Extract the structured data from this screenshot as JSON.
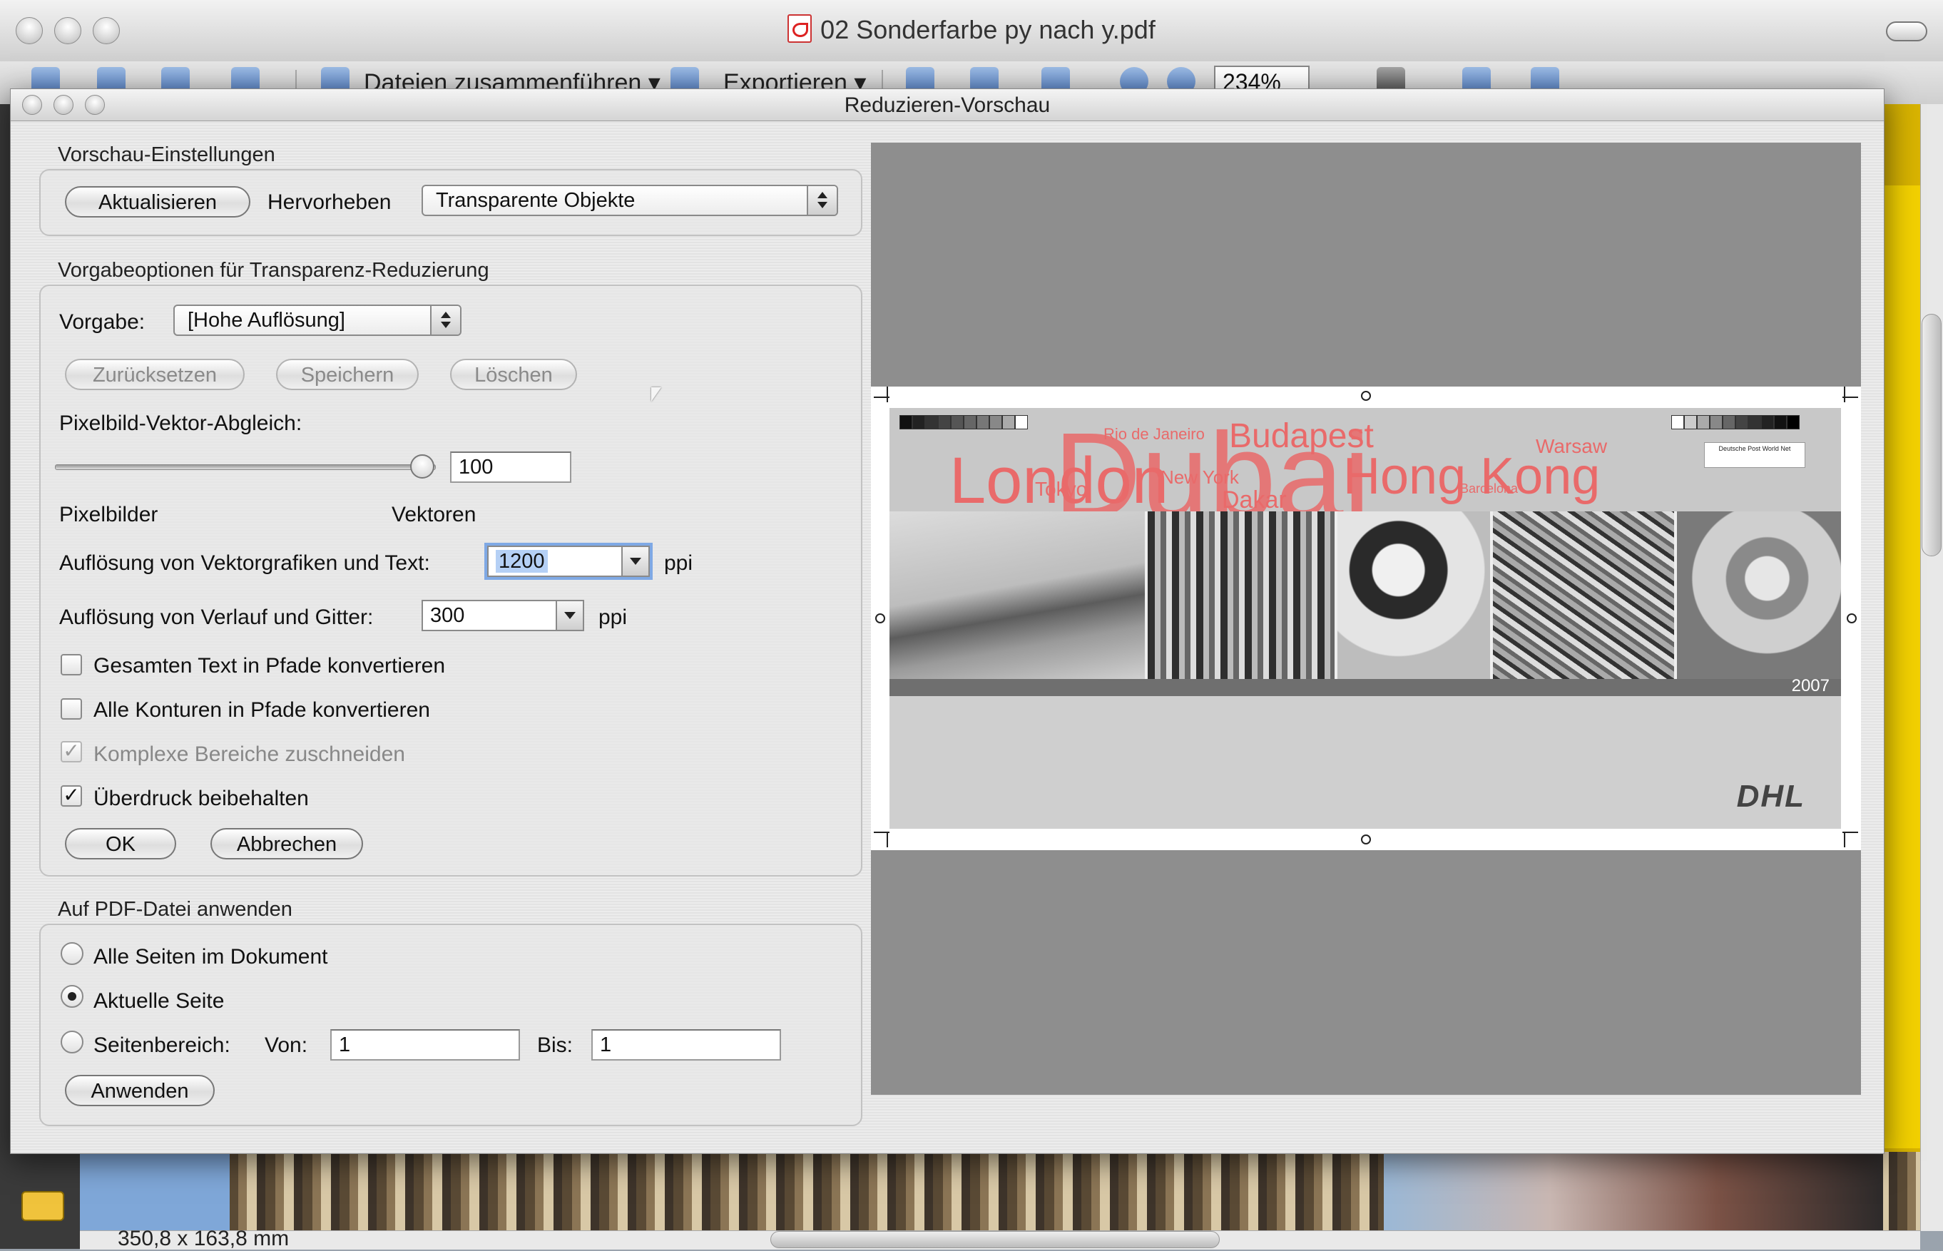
{
  "app": {
    "window_title": "02 Sonderfarbe py nach y.pdf",
    "toolbar": {
      "merge_label": "Dateien zusammenführen ▾",
      "export_label": "Exportieren ▾",
      "zoom_value": "234%"
    },
    "page_size": "350,8 x 163,8 mm"
  },
  "dialog": {
    "title": "Reduzieren-Vorschau",
    "preview_settings": {
      "section_label": "Vorschau-Einstellungen",
      "refresh_button": "Aktualisieren",
      "highlight_label": "Hervorheben",
      "highlight_value": "Transparente Objekte"
    },
    "preset_options": {
      "section_label": "Vorgabeoptionen für Transparenz-Reduzierung",
      "preset_label": "Vorgabe:",
      "preset_value": "[Hohe Auflösung]",
      "reset_button": "Zurücksetzen",
      "save_button": "Speichern",
      "delete_button": "Löschen",
      "raster_vector_label": "Pixelbild-Vektor-Abgleich:",
      "raster_vector_value": "100",
      "raster_vector_level": 1.0,
      "slider_left_label": "Pixelbilder",
      "slider_right_label": "Vektoren",
      "vector_res_label": "Auflösung von Vektorgrafiken und Text:",
      "vector_res_value": "1200",
      "vector_res_unit": "ppi",
      "gradient_res_label": "Auflösung von Verlauf und Gitter:",
      "gradient_res_value": "300",
      "gradient_res_unit": "ppi",
      "checkboxes": [
        {
          "label": "Gesamten Text in Pfade konvertieren",
          "checked": false,
          "enabled": true
        },
        {
          "label": "Alle Konturen in Pfade konvertieren",
          "checked": false,
          "enabled": true
        },
        {
          "label": "Komplexe Bereiche zuschneiden",
          "checked": true,
          "enabled": false
        },
        {
          "label": "Überdruck beibehalten",
          "checked": true,
          "enabled": true
        }
      ],
      "ok_button": "OK",
      "cancel_button": "Abbrechen"
    },
    "apply_to_pdf": {
      "section_label": "Auf PDF-Datei anwenden",
      "radios": [
        {
          "label": "Alle Seiten im Dokument",
          "selected": false
        },
        {
          "label": "Aktuelle Seite",
          "selected": true
        },
        {
          "label": "Seitenbereich:",
          "selected": false
        }
      ],
      "from_label": "Von:",
      "from_value": "1",
      "to_label": "Bis:",
      "to_value": "1",
      "apply_button": "Anwenden"
    },
    "preview": {
      "cities": [
        "London",
        "Dubai",
        "Rio de Janeiro",
        "Budapest",
        "Hong Kong",
        "Warsaw",
        "New York",
        "Tokyo",
        "Dakar",
        "Barcelona"
      ],
      "year": "2007",
      "brand": "DHL",
      "partner_logo": "Deutsche Post World Net",
      "highlight_color": "#e96a6a"
    }
  }
}
